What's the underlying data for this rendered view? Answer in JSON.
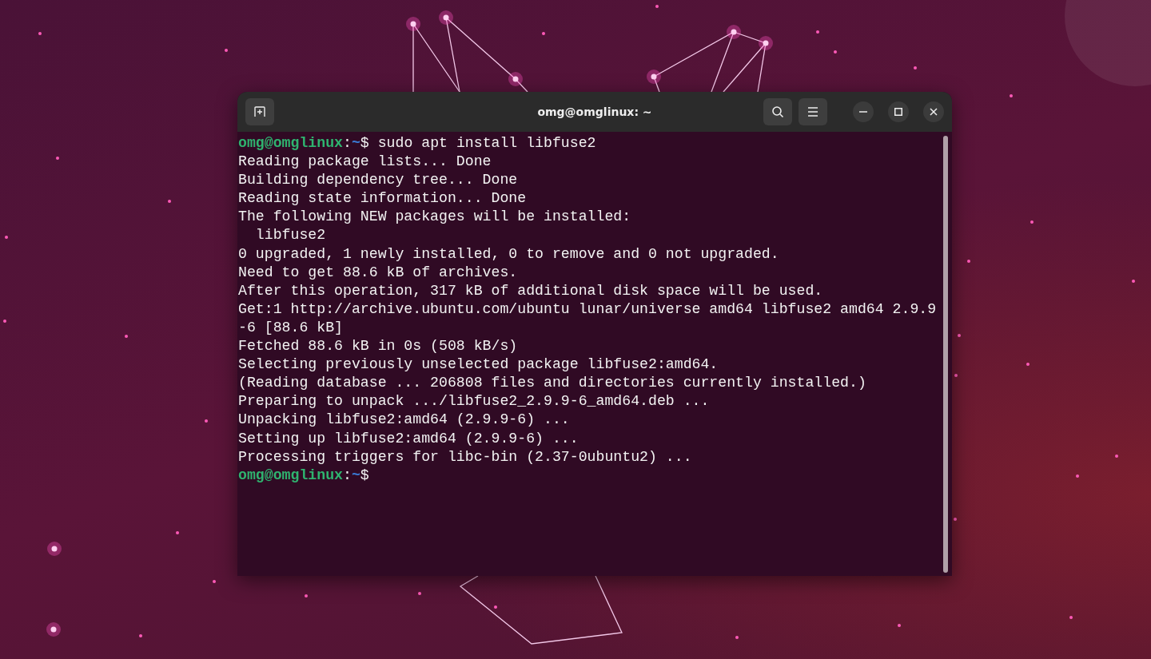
{
  "window": {
    "title": "omg@omglinux: ~"
  },
  "terminal": {
    "lines": [
      {
        "kind": "prompt",
        "user": "omg@omglinux",
        "sep": ":",
        "path": "~",
        "command": "$ sudo apt install libfuse2"
      },
      {
        "kind": "output",
        "text": "Reading package lists... Done"
      },
      {
        "kind": "output",
        "text": "Building dependency tree... Done"
      },
      {
        "kind": "output",
        "text": "Reading state information... Done"
      },
      {
        "kind": "output",
        "text": "The following NEW packages will be installed:"
      },
      {
        "kind": "output",
        "text": "  libfuse2"
      },
      {
        "kind": "output",
        "text": "0 upgraded, 1 newly installed, 0 to remove and 0 not upgraded."
      },
      {
        "kind": "output",
        "text": "Need to get 88.6 kB of archives."
      },
      {
        "kind": "output",
        "text": "After this operation, 317 kB of additional disk space will be used."
      },
      {
        "kind": "output",
        "text": "Get:1 http://archive.ubuntu.com/ubuntu lunar/universe amd64 libfuse2 amd64 2.9.9"
      },
      {
        "kind": "output",
        "text": "-6 [88.6 kB]"
      },
      {
        "kind": "output",
        "text": "Fetched 88.6 kB in 0s (508 kB/s)"
      },
      {
        "kind": "output",
        "text": "Selecting previously unselected package libfuse2:amd64."
      },
      {
        "kind": "output",
        "text": "(Reading database ... 206808 files and directories currently installed.)"
      },
      {
        "kind": "output",
        "text": "Preparing to unpack .../libfuse2_2.9.9-6_amd64.deb ..."
      },
      {
        "kind": "output",
        "text": "Unpacking libfuse2:amd64 (2.9.9-6) ..."
      },
      {
        "kind": "output",
        "text": "Setting up libfuse2:amd64 (2.9.9-6) ..."
      },
      {
        "kind": "output",
        "text": "Processing triggers for libc-bin (2.37-0ubuntu2) ..."
      },
      {
        "kind": "prompt",
        "user": "omg@omglinux",
        "sep": ":",
        "path": "~",
        "command": "$"
      }
    ]
  }
}
